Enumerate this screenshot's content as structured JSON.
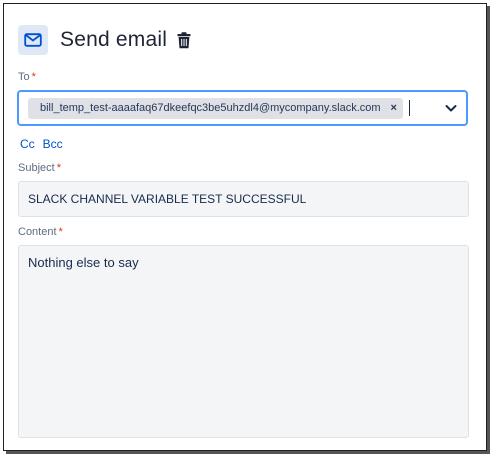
{
  "header": {
    "title": "Send email",
    "icon": "mail-icon",
    "action_icon": "trash-icon"
  },
  "to": {
    "label": "To",
    "required_mark": "*",
    "recipients": [
      {
        "email": "bill_temp_test-aaaafaq67dkeefqc3be5uhzdl4@mycompany.slack.com",
        "remove_label": "×"
      }
    ]
  },
  "copy_links": {
    "cc": "Cc",
    "bcc": "Bcc"
  },
  "subject": {
    "label": "Subject",
    "required_mark": "*",
    "value": "SLACK CHANNEL VARIABLE TEST SUCCESSFUL"
  },
  "content": {
    "label": "Content",
    "required_mark": "*",
    "value": "Nothing else to say"
  },
  "colors": {
    "accent": "#4c9aff",
    "link": "#0052cc",
    "required": "#de350b"
  }
}
